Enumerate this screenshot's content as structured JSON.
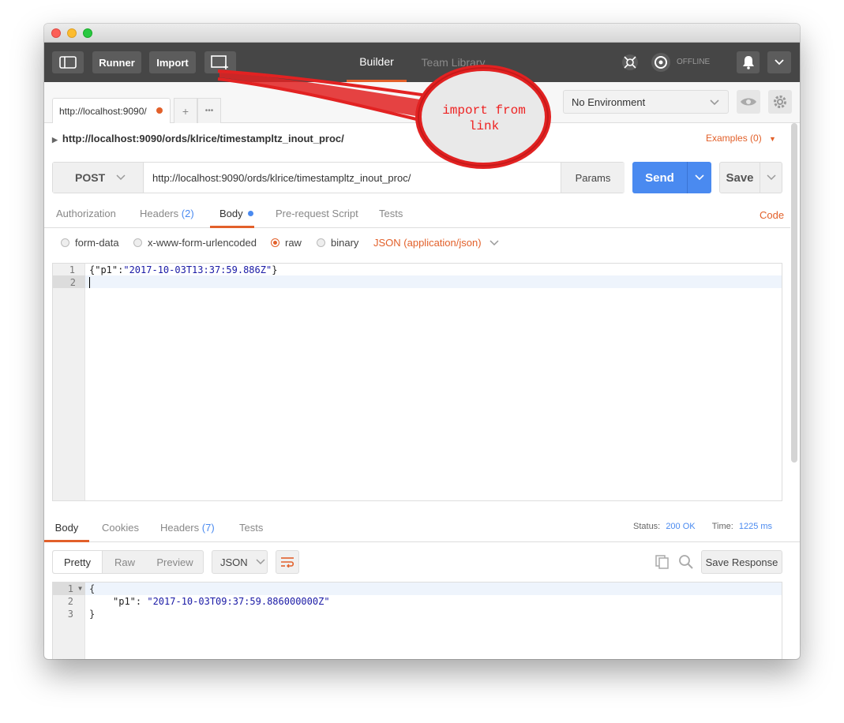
{
  "toolbar": {
    "runner_label": "Runner",
    "import_label": "Import",
    "builder_label": "Builder",
    "team_library_label": "Team Library",
    "offline_label": "OFFLINE"
  },
  "request_tab": {
    "label": "http://localhost:9090/",
    "add_label": "+",
    "more_label": "•••"
  },
  "environment": {
    "selected": "No Environment"
  },
  "request": {
    "url_title": "http://localhost:9090/ords/klrice/timestampltz_inout_proc/",
    "examples_label": "Examples (0)",
    "method": "POST",
    "url": "http://localhost:9090/ords/klrice/timestampltz_inout_proc/",
    "params_label": "Params",
    "send_label": "Send",
    "save_label": "Save"
  },
  "request_tabs": {
    "authorization": "Authorization",
    "headers": "Headers",
    "headers_count": "(2)",
    "body": "Body",
    "prerequest": "Pre-request Script",
    "tests": "Tests",
    "code": "Code"
  },
  "body_modes": {
    "form_data": "form-data",
    "urlencoded": "x-www-form-urlencoded",
    "raw": "raw",
    "binary": "binary",
    "content_type": "JSON (application/json)"
  },
  "request_body": {
    "lines": [
      "1",
      "2"
    ],
    "key": "{\"p1\":",
    "value": "\"2017-10-03T13:37:59.886Z\"",
    "close": "}"
  },
  "response_tabs": {
    "body": "Body",
    "cookies": "Cookies",
    "headers": "Headers",
    "headers_count": "(7)",
    "tests": "Tests",
    "status_label": "Status:",
    "status_value": "200 OK",
    "time_label": "Time:",
    "time_value": "1225 ms"
  },
  "response_toolbar": {
    "pretty": "Pretty",
    "raw": "Raw",
    "preview": "Preview",
    "format": "JSON",
    "save_response": "Save Response"
  },
  "response_body": {
    "lines": [
      "1",
      "2",
      "3"
    ],
    "open": "{",
    "key": "\"p1\":",
    "value": "\"2017-10-03T09:37:59.886000000Z\"",
    "close": "}"
  },
  "annotation": {
    "line1": "import from",
    "line2": "link"
  },
  "colors": {
    "accent_orange": "#e2602a",
    "send_blue": "#4a8af0",
    "toolbar_dark": "#464646",
    "annotation_red": "#e22222"
  }
}
